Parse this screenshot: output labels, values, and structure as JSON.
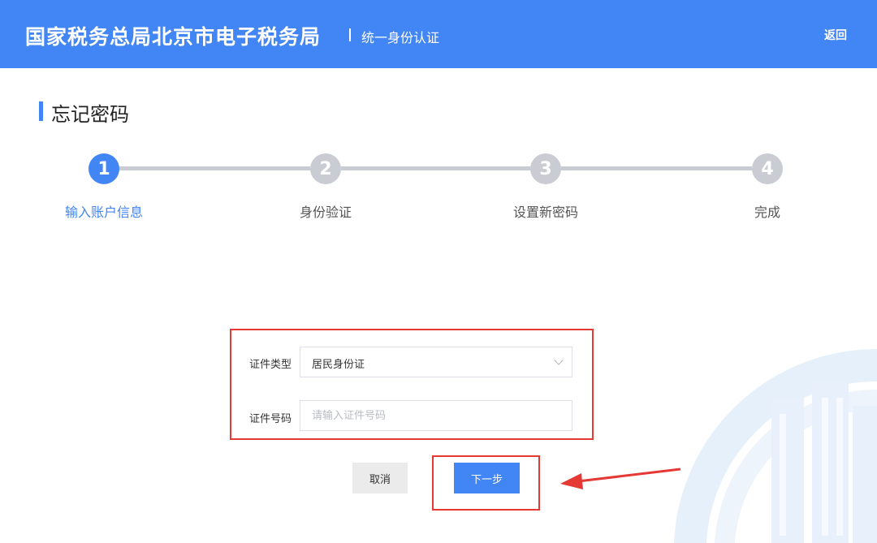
{
  "header": {
    "brand": "国家税务总局北京市电子税务局",
    "subtitle": "统一身份认证",
    "back_label": "返回"
  },
  "page": {
    "title": "忘记密码"
  },
  "steps": [
    {
      "number": "1",
      "label": "输入账户信息",
      "active": true
    },
    {
      "number": "2",
      "label": "身份验证",
      "active": false
    },
    {
      "number": "3",
      "label": "设置新密码",
      "active": false
    },
    {
      "number": "4",
      "label": "完成",
      "active": false
    }
  ],
  "form": {
    "id_type_label": "证件类型",
    "id_type_value": "居民身份证",
    "id_number_label": "证件号码",
    "id_number_placeholder": "请输入证件号码",
    "id_number_value": ""
  },
  "actions": {
    "cancel_label": "取消",
    "next_label": "下一步"
  },
  "colors": {
    "primary": "#4285f4",
    "inactive_step": "#c9ccd2",
    "highlight": "#e53935"
  }
}
